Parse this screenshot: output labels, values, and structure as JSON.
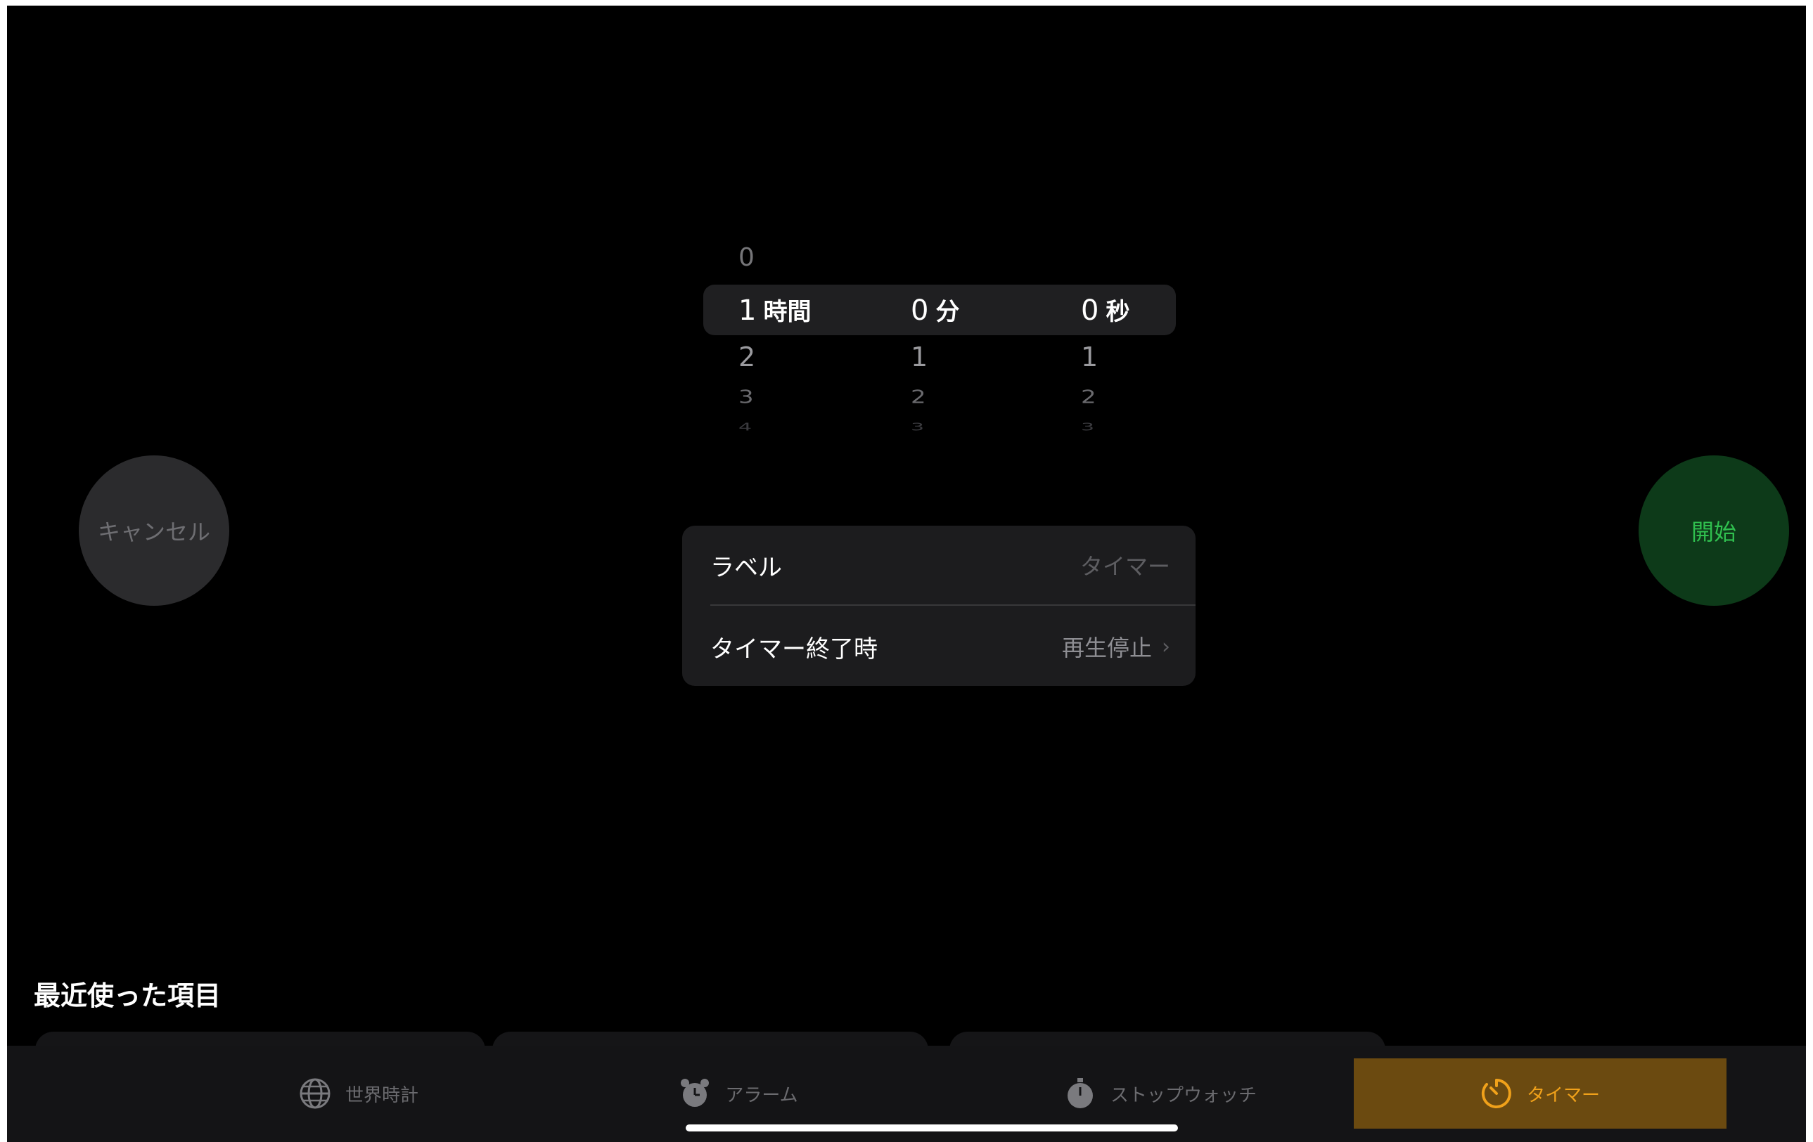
{
  "picker": {
    "hours": {
      "above": "0",
      "selected": "1",
      "unit": "時間",
      "below": [
        "2",
        "3",
        "4"
      ]
    },
    "minutes": {
      "selected": "0",
      "unit": "分",
      "below": [
        "1",
        "2",
        "3"
      ]
    },
    "seconds": {
      "selected": "0",
      "unit": "秒",
      "below": [
        "1",
        "2",
        "3"
      ]
    }
  },
  "buttons": {
    "cancel": "キャンセル",
    "start": "開始"
  },
  "settings": {
    "label_title": "ラベル",
    "label_placeholder": "タイマー",
    "end_title": "タイマー終了時",
    "end_value": "再生停止",
    "chevron": "›"
  },
  "recents": {
    "title": "最近使った項目"
  },
  "tabbar": {
    "world_clock": "世界時計",
    "alarm": "アラーム",
    "stopwatch": "ストップウォッチ",
    "timer": "タイマー",
    "active_tab": "timer"
  },
  "colors": {
    "accent": "#f0a11a",
    "start_green": "#30c04f",
    "background": "#000000"
  }
}
